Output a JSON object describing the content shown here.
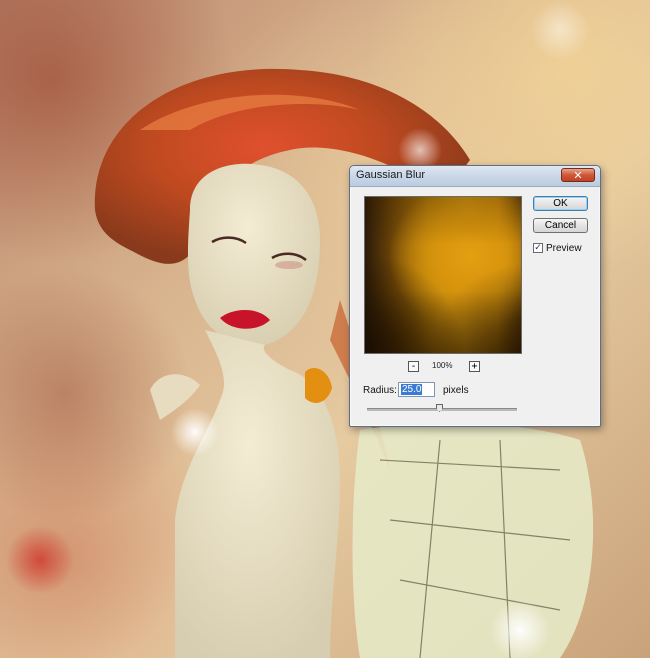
{
  "dialog": {
    "title": "Gaussian Blur",
    "close_glyph": "✕",
    "buttons": {
      "ok": "OK",
      "cancel": "Cancel"
    },
    "preview": {
      "label": "Preview",
      "checked": true,
      "check_glyph": "✓"
    },
    "zoom": {
      "minus": "-",
      "level": "100%",
      "plus": "+"
    },
    "radius": {
      "label": "Radius:",
      "value": "25.0",
      "units": "pixels"
    }
  }
}
